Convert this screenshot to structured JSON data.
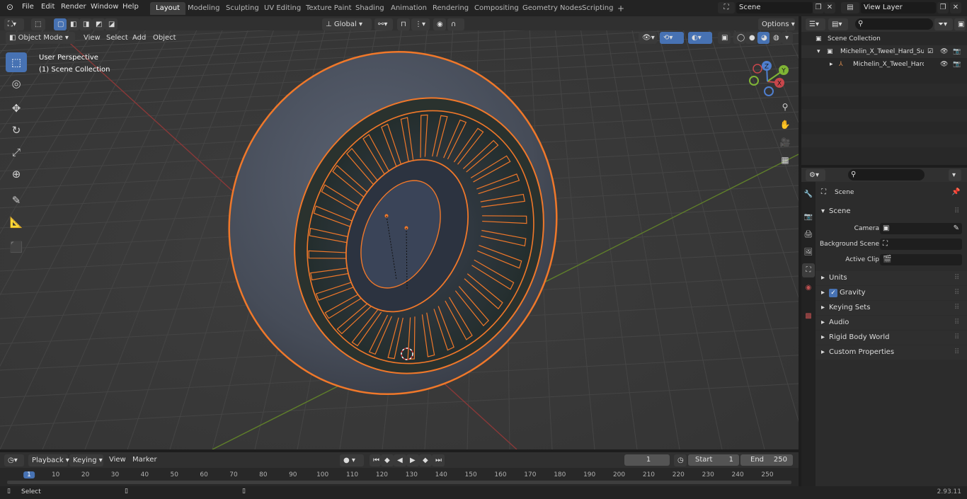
{
  "topbar": {
    "menus": [
      "File",
      "Edit",
      "Render",
      "Window",
      "Help"
    ],
    "workspaces": [
      "Layout",
      "Modeling",
      "Sculpting",
      "UV Editing",
      "Texture Paint",
      "Shading",
      "Animation",
      "Rendering",
      "Compositing",
      "Geometry Nodes",
      "Scripting"
    ],
    "active_workspace": "Layout",
    "scene": "Scene",
    "view_layer": "View Layer"
  },
  "viewport": {
    "mode": "Object Mode",
    "menus": [
      "View",
      "Select",
      "Add",
      "Object"
    ],
    "transform_orientation": "Global",
    "options_label": "Options",
    "overlay_title": "User Perspective",
    "overlay_subtitle": "(1) Scene Collection",
    "gizmo_axes": [
      "X",
      "Y",
      "Z"
    ]
  },
  "outliner": {
    "root": "Scene Collection",
    "items": [
      "Michelin_X_Tweel_Hard_Surfa",
      "Michelin_X_Tweel_Hard_S"
    ]
  },
  "properties": {
    "context": "Scene",
    "section": "Scene",
    "fields": [
      {
        "label": "Camera"
      },
      {
        "label": "Background Scene"
      },
      {
        "label": "Active Clip"
      }
    ],
    "panels": [
      "Units",
      "Gravity",
      "Keying Sets",
      "Audio",
      "Rigid Body World",
      "Custom Properties"
    ],
    "gravity_checked": true
  },
  "timeline": {
    "menus": [
      "Playback",
      "Keying",
      "View",
      "Marker"
    ],
    "current_frame": "1",
    "start_label": "Start",
    "start": "1",
    "end_label": "End",
    "end": "250",
    "ticks": [
      "1",
      "10",
      "20",
      "30",
      "40",
      "50",
      "60",
      "70",
      "80",
      "90",
      "100",
      "110",
      "120",
      "130",
      "140",
      "150",
      "160",
      "170",
      "180",
      "190",
      "200",
      "210",
      "220",
      "230",
      "240",
      "250"
    ]
  },
  "statusbar": {
    "left": "Select",
    "version": "2.93.11"
  },
  "colors": {
    "accent": "#4772b3",
    "selection_outline": "#f0782a",
    "x_axis": "#c8464b",
    "y_axis": "#7fb435",
    "z_axis": "#4f7fcf"
  }
}
